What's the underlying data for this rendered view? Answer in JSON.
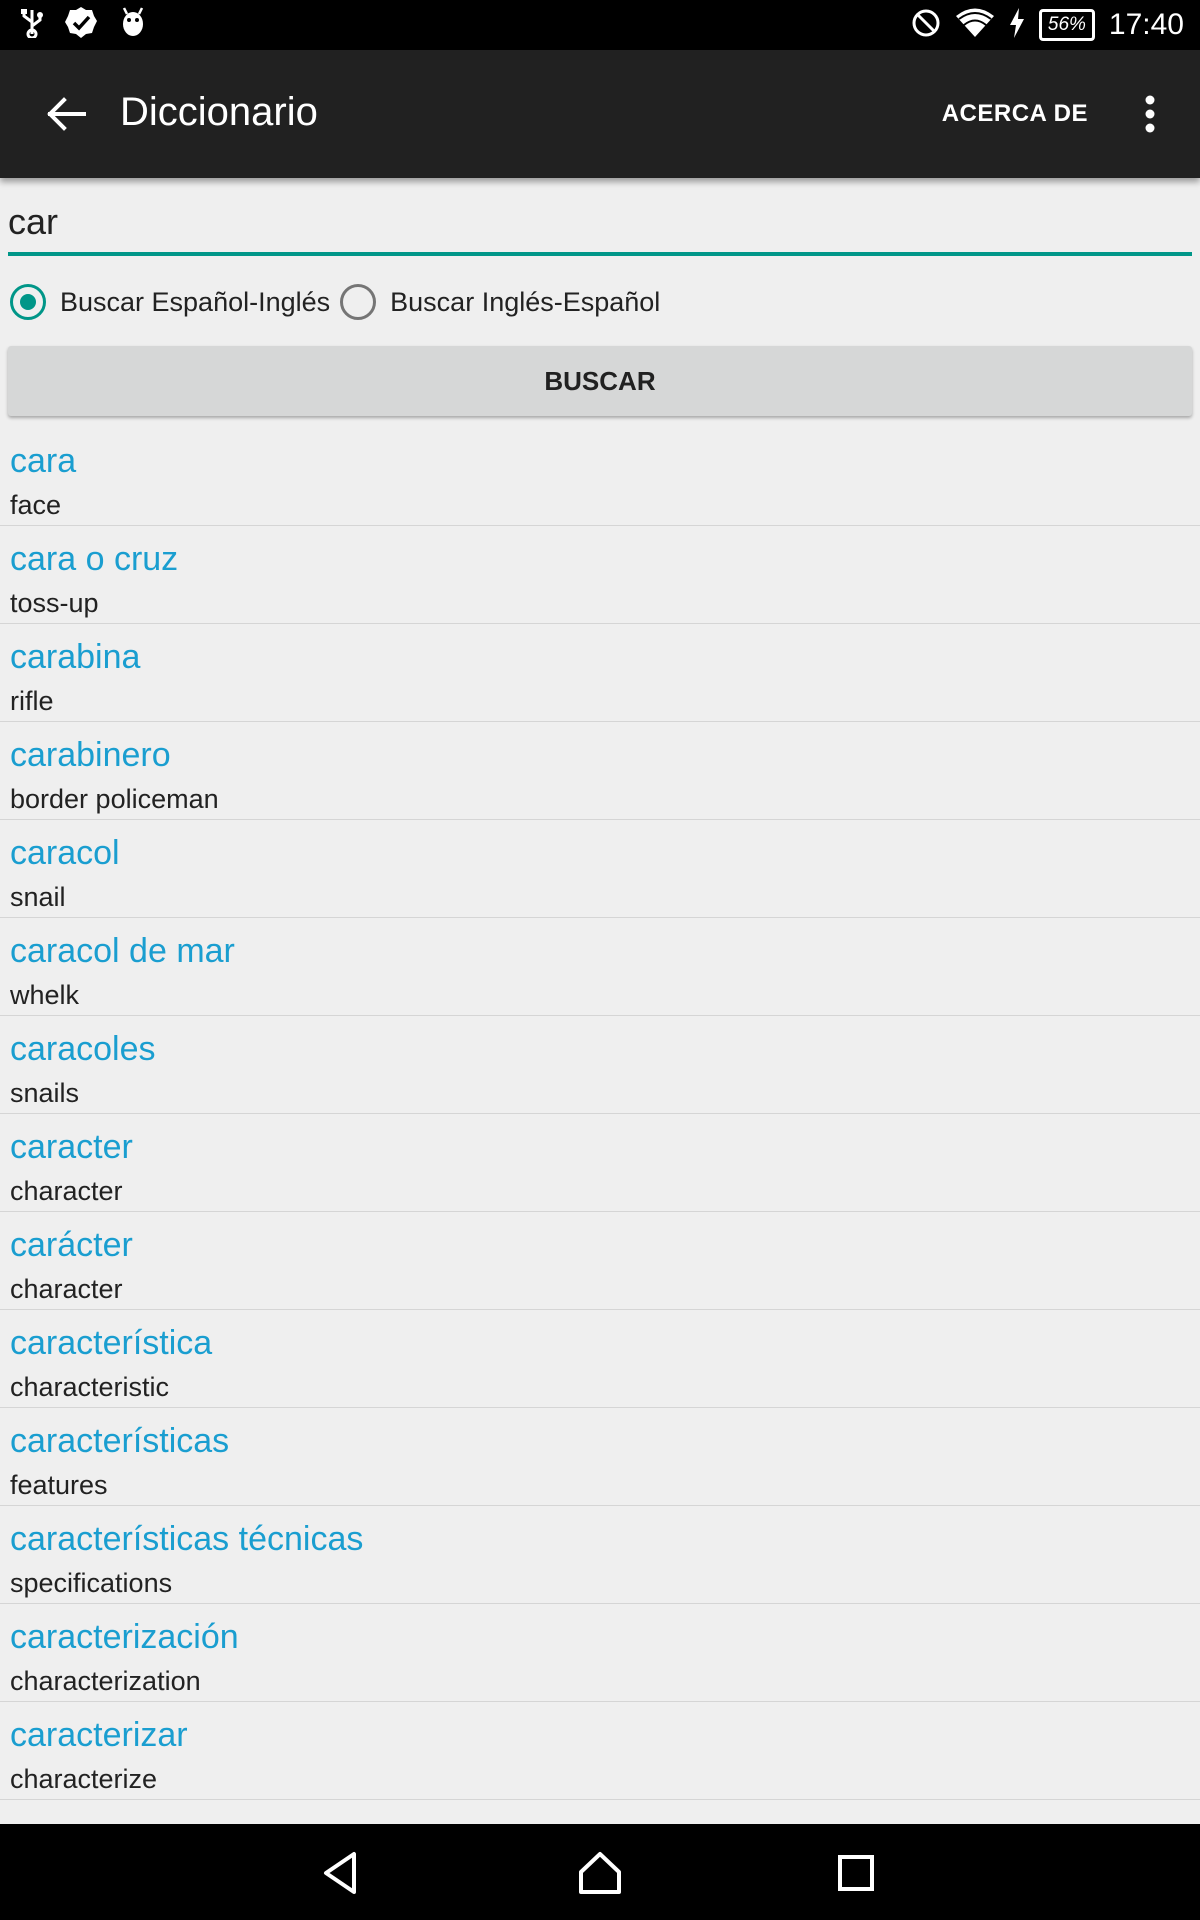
{
  "status_bar": {
    "time": "17:40",
    "battery": "56%",
    "icons": [
      "usb-icon",
      "check-badge-icon",
      "android-debug-icon",
      "do-not-disturb-icon",
      "wifi-icon",
      "charging-icon",
      "battery-icon"
    ]
  },
  "app_bar": {
    "title": "Diccionario",
    "about_label": "ACERCA DE",
    "back_icon": "arrow-back-icon",
    "overflow_icon": "more-vert-icon"
  },
  "search": {
    "value": "car",
    "placeholder": ""
  },
  "mode": {
    "option_es_en": "Buscar Español-Inglés",
    "option_en_es": "Buscar Inglés-Español",
    "selected": "es_en"
  },
  "buscar_label": "BUSCAR",
  "results": [
    {
      "term": "cara",
      "translation": "face"
    },
    {
      "term": "cara o cruz",
      "translation": "toss-up"
    },
    {
      "term": "carabina",
      "translation": "rifle"
    },
    {
      "term": "carabinero",
      "translation": "border policeman"
    },
    {
      "term": "caracol",
      "translation": "snail"
    },
    {
      "term": "caracol de mar",
      "translation": "whelk"
    },
    {
      "term": "caracoles",
      "translation": "snails"
    },
    {
      "term": "caracter",
      "translation": "character"
    },
    {
      "term": "carácter",
      "translation": "character"
    },
    {
      "term": "característica",
      "translation": "characteristic"
    },
    {
      "term": "características",
      "translation": "features"
    },
    {
      "term": "características técnicas",
      "translation": "specifications"
    },
    {
      "term": "caracterización",
      "translation": "characterization"
    },
    {
      "term": "caracterizar",
      "translation": "characterize"
    }
  ],
  "colors": {
    "accent": "#009688",
    "term": "#1a9ed0",
    "app_bar": "#212121",
    "background": "#efefef"
  },
  "nav_bar": {
    "icons": [
      "back-triangle-icon",
      "home-icon",
      "recents-icon"
    ]
  }
}
